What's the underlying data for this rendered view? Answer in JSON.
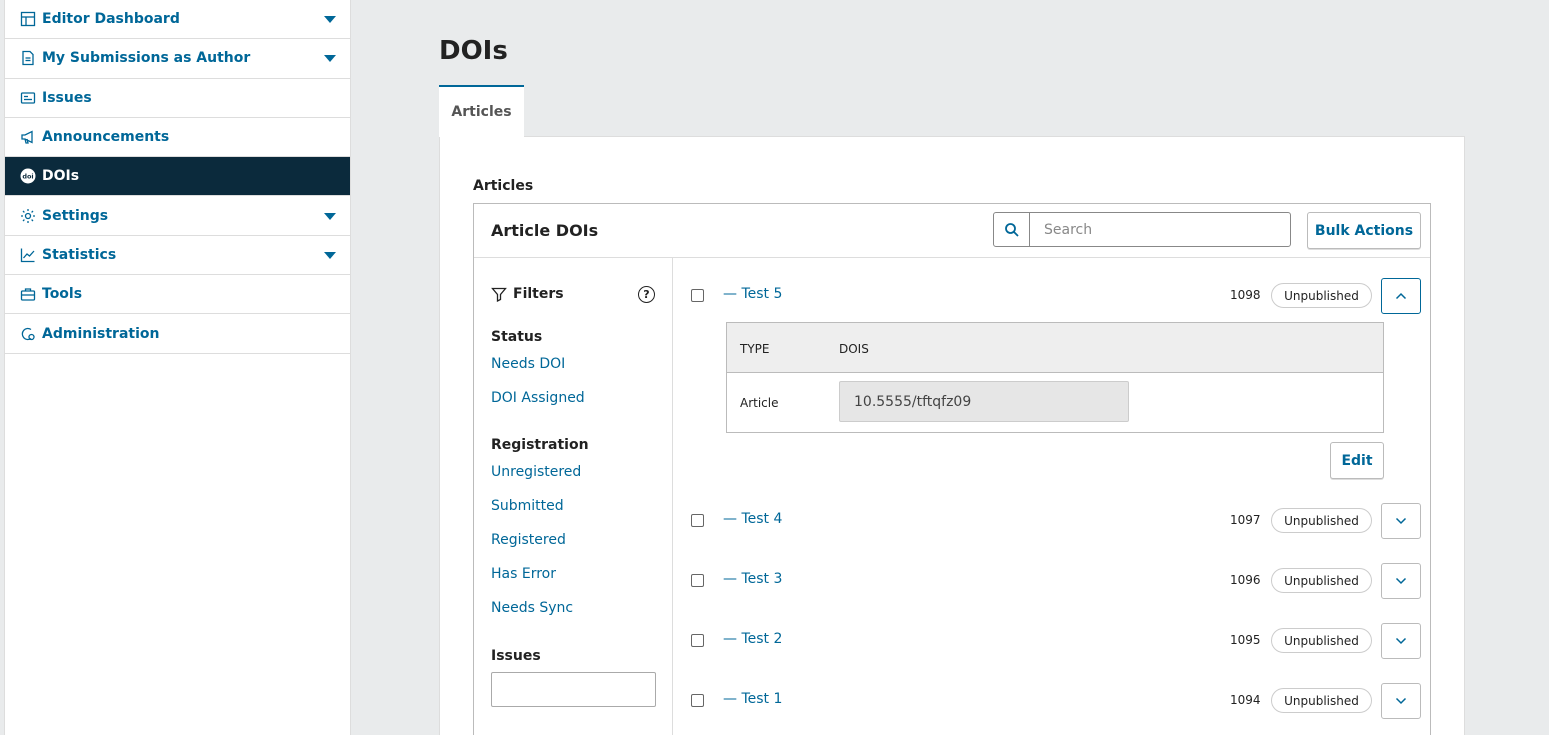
{
  "sidebar": {
    "items": [
      {
        "label": "Editor Dashboard",
        "icon": "dashboard-icon"
      },
      {
        "label": "My Submissions as Author",
        "icon": "document-icon"
      },
      {
        "label": "Issues",
        "icon": "issues-icon"
      },
      {
        "label": "Announcements",
        "icon": "megaphone-icon"
      },
      {
        "label": "DOIs",
        "icon": "doi-icon",
        "active": true
      },
      {
        "label": "Settings",
        "icon": "gear-icon"
      },
      {
        "label": "Statistics",
        "icon": "chart-icon"
      },
      {
        "label": "Tools",
        "icon": "toolbox-icon"
      },
      {
        "label": "Administration",
        "icon": "admin-icon"
      }
    ]
  },
  "page": {
    "title": "DOIs",
    "tab_label": "Articles",
    "section_label": "Articles"
  },
  "list": {
    "title": "Article DOIs",
    "search_placeholder": "Search",
    "bulk_actions_label": "Bulk Actions"
  },
  "filters": {
    "heading": "Filters",
    "help_glyph": "?",
    "status_title": "Status",
    "status_options": [
      "Needs DOI",
      "DOI Assigned"
    ],
    "registration_title": "Registration",
    "registration_options": [
      "Unregistered",
      "Submitted",
      "Registered",
      "Has Error",
      "Needs Sync"
    ],
    "issues_title": "Issues"
  },
  "rows": [
    {
      "title": "— Test 5",
      "id": "1098",
      "status": "Unpublished",
      "expanded": true
    },
    {
      "title": "— Test 4",
      "id": "1097",
      "status": "Unpublished",
      "expanded": false
    },
    {
      "title": "— Test 3",
      "id": "1096",
      "status": "Unpublished",
      "expanded": false
    },
    {
      "title": "— Test 2",
      "id": "1095",
      "status": "Unpublished",
      "expanded": false
    },
    {
      "title": "— Test 1",
      "id": "1094",
      "status": "Unpublished",
      "expanded": false
    }
  ],
  "details": {
    "col_type": "TYPE",
    "col_dois": "DOIS",
    "type_value": "Article",
    "doi_value": "10.5555/tftqfz09",
    "edit_label": "Edit"
  },
  "colors": {
    "accent": "#006798",
    "active_nav_bg": "#0b2a3c",
    "page_bg": "#e9ebec"
  }
}
